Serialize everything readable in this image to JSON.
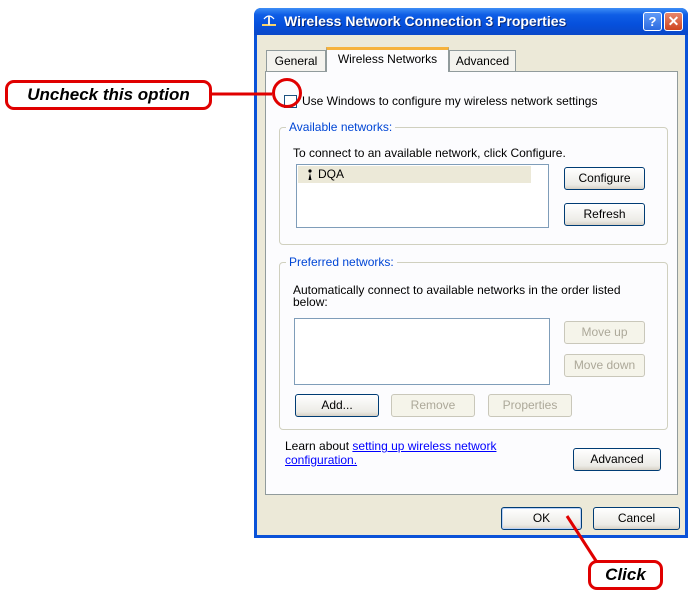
{
  "window": {
    "title": "Wireless Network Connection 3 Properties",
    "help_label": "?",
    "close_label": "✕"
  },
  "tabs": [
    {
      "label": "General",
      "selected": false
    },
    {
      "label": "Wireless Networks",
      "selected": true
    },
    {
      "label": "Advanced",
      "selected": false
    }
  ],
  "use_windows_checkbox": {
    "label": "Use Windows to configure my wireless network settings",
    "checked": false
  },
  "available_networks": {
    "title": "Available networks:",
    "description": "To connect to an available network, click Configure.",
    "networks": [
      "DQA"
    ],
    "configure_label": "Configure",
    "refresh_label": "Refresh"
  },
  "preferred_networks": {
    "title": "Preferred networks:",
    "description_line1": "Automatically connect to available networks in the order listed",
    "description_line2": "below:",
    "move_up_label": "Move up",
    "move_down_label": "Move down",
    "add_label": "Add...",
    "remove_label": "Remove",
    "properties_label": "Properties"
  },
  "learn_more": {
    "prefix": "Learn about ",
    "link_line1": "setting up wireless network",
    "link_line2": "configuration.",
    "advanced_label": "Advanced"
  },
  "footer": {
    "ok_label": "OK",
    "cancel_label": "Cancel"
  },
  "annotations": {
    "uncheck": "Uncheck this option",
    "click": "Click",
    "color": "#e00000"
  }
}
